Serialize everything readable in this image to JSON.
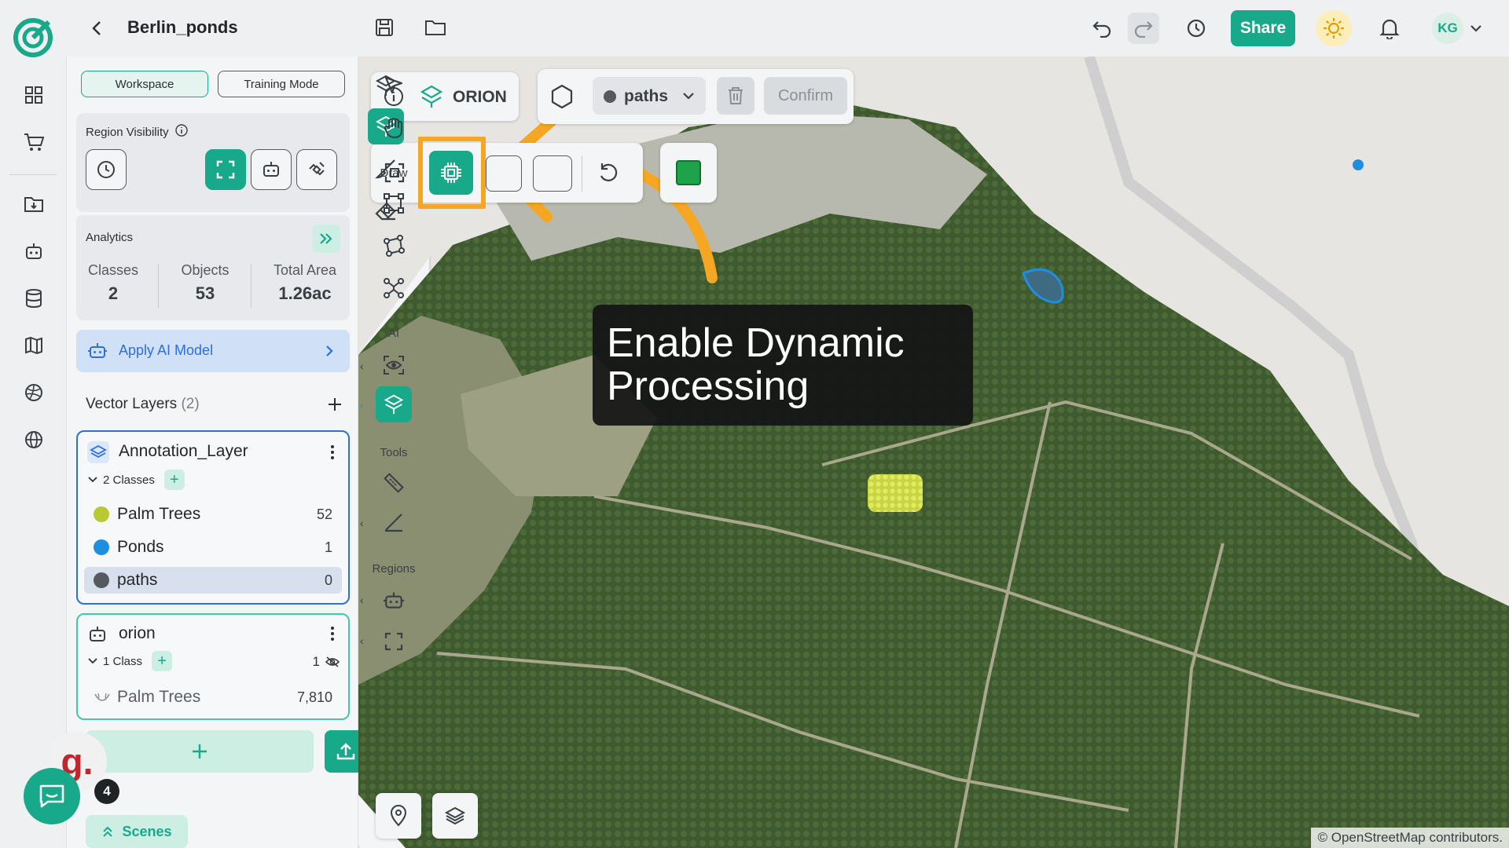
{
  "header": {
    "project_title": "Berlin_ponds",
    "share_label": "Share",
    "avatar_initials": "KG"
  },
  "panel": {
    "workspace_label": "Workspace",
    "training_label": "Training Mode",
    "region_visibility_label": "Region Visibility",
    "analytics": {
      "title": "Analytics",
      "stats": [
        {
          "label": "Classes",
          "value": "2"
        },
        {
          "label": "Objects",
          "value": "53"
        },
        {
          "label": "Total Area",
          "value": "1.26ac"
        }
      ]
    },
    "apply_ai_label": "Apply AI Model",
    "vector_layers_title": "Vector Layers",
    "vector_layers_count": "(2)",
    "layers": [
      {
        "name": "Annotation_Layer",
        "classes_label": "2 Classes",
        "classes": [
          {
            "name": "Palm Trees",
            "count": "52",
            "color": "#b9c933"
          },
          {
            "name": "Ponds",
            "count": "1",
            "color": "#1d8ee0"
          },
          {
            "name": "paths",
            "count": "0",
            "color": "#555a60"
          }
        ]
      },
      {
        "name": "orion",
        "classes_label": "1 Class",
        "hidden_count": "1",
        "classes": [
          {
            "name": "Palm Trees",
            "count": "7,810"
          }
        ]
      }
    ],
    "scenes_label": "Scenes"
  },
  "map": {
    "orion_label": "ORION",
    "class_dropdown_label": "paths",
    "confirm_label": "Confirm",
    "tooltip_text": "Enable Dynamic Processing",
    "attribution": "© OpenStreetMap contributors.",
    "right_toolbar": {
      "draw_label": "Draw",
      "ai_label": "AI",
      "tools_label": "Tools",
      "regions_label": "Regions"
    }
  },
  "chat": {
    "badge_letter": "g.",
    "unread_count": "4"
  },
  "colors": {
    "accent": "#18a88a",
    "highlight": "#f5a623",
    "selected_layer_border": "#2f6fd6"
  }
}
